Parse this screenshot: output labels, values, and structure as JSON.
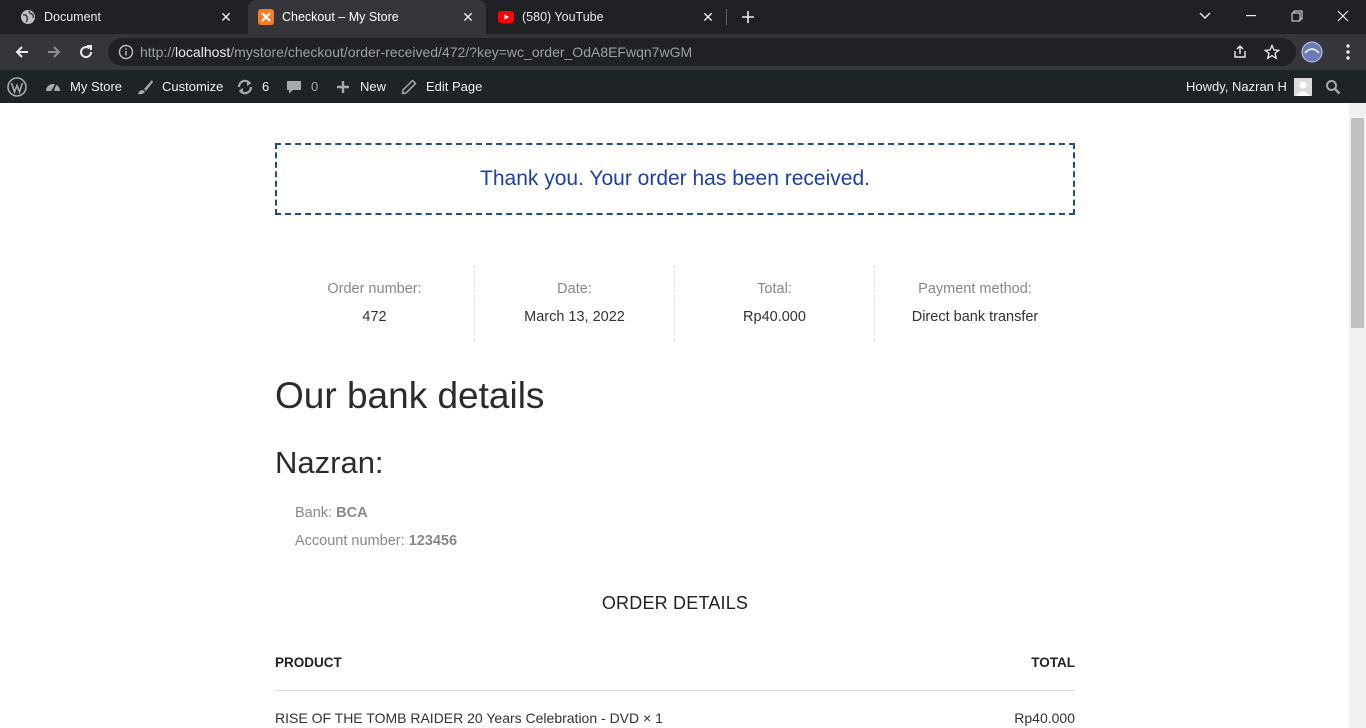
{
  "browser": {
    "tabs": [
      {
        "title": "Document",
        "icon": "globe-icon",
        "active": false
      },
      {
        "title": "Checkout – My Store",
        "icon": "xampp-icon",
        "active": true
      },
      {
        "title": "(580) YouTube",
        "icon": "youtube-icon",
        "active": false
      }
    ],
    "close_glyph": "✕",
    "url": {
      "scheme": "http://",
      "host": "localhost",
      "path": "/mystore/checkout/order-received/472/?key=wc_order_OdA8EFwqn7wGM"
    }
  },
  "adminbar": {
    "site_name": "My Store",
    "customize": "Customize",
    "updates_count": "6",
    "comments_count": "0",
    "new_label": "New",
    "edit_page": "Edit Page",
    "howdy": "Howdy, Nazran H"
  },
  "page": {
    "notice": "Thank you. Your order has been received.",
    "overview": [
      {
        "label": "Order number:",
        "value": "472"
      },
      {
        "label": "Date:",
        "value": "March 13, 2022"
      },
      {
        "label": "Total:",
        "value": "Rp40.000"
      },
      {
        "label": "Payment method:",
        "value": "Direct bank transfer"
      }
    ],
    "bank_heading": "Our bank details",
    "account_name": "Nazran:",
    "bank_label": "Bank:",
    "bank_value": "BCA",
    "account_label": "Account number:",
    "account_value": "123456",
    "order_details_title": "ORDER DETAILS",
    "table": {
      "col_product": "PRODUCT",
      "col_total": "TOTAL",
      "rows": [
        {
          "product": "RISE OF THE TOMB RAIDER 20 Years Celebration - DVD × 1",
          "total": "Rp40.000"
        }
      ]
    }
  },
  "colors": {
    "notice_text": "#1e40a6",
    "notice_border": "#1d4e89",
    "adminbar_bg": "#1d2327",
    "youtube_red": "#ff0000",
    "xampp_orange": "#fb7a24"
  }
}
